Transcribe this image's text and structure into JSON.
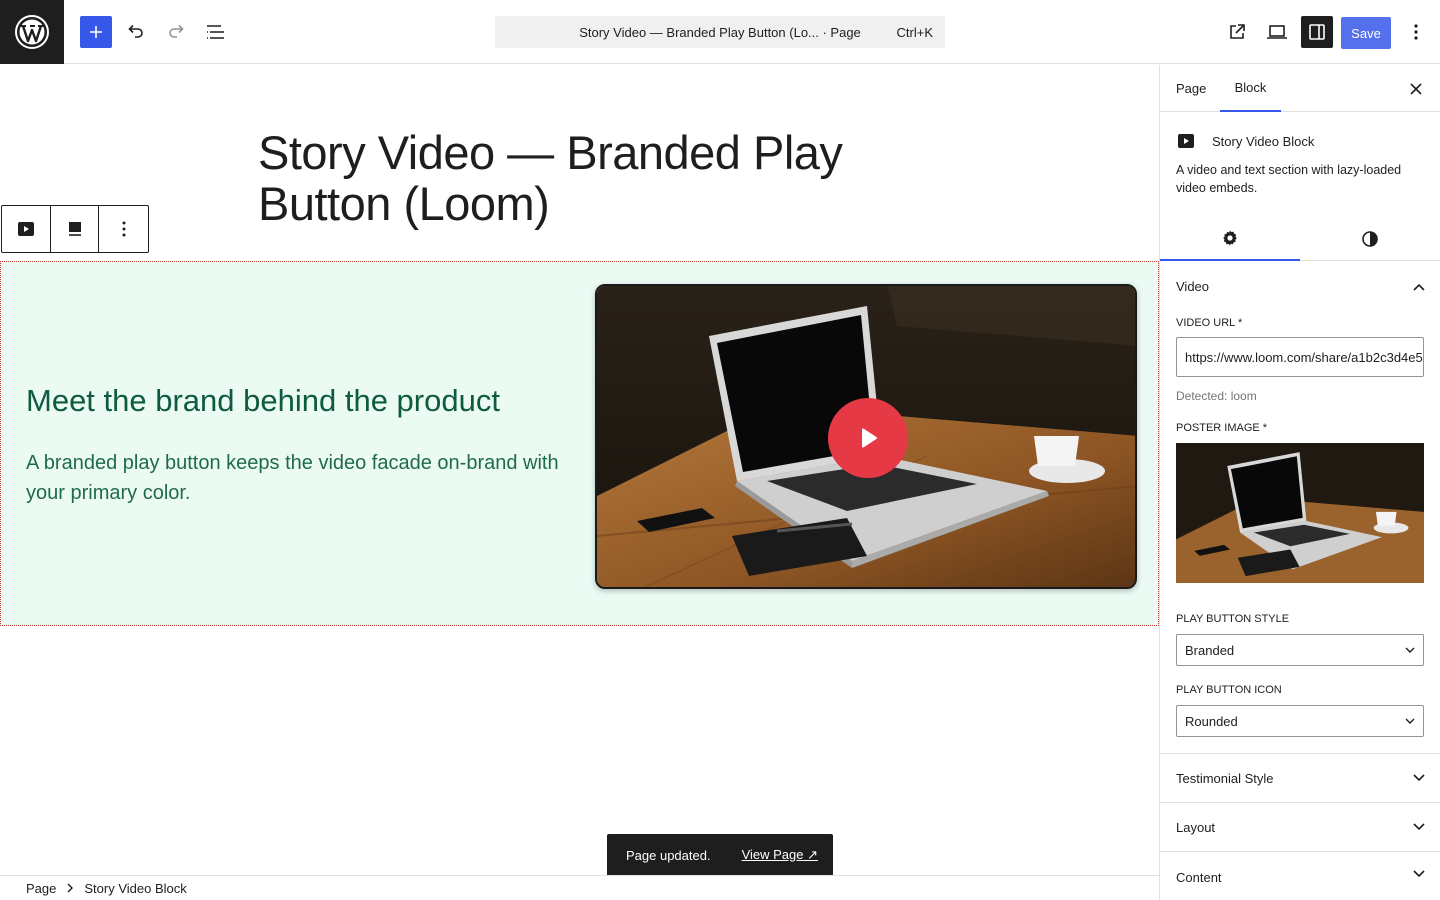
{
  "toolbar": {
    "document_title": "Story Video — Branded Play Button (Lo... · Page",
    "command_shortcut": "Ctrl+K",
    "save_label": "Save"
  },
  "editor": {
    "page_title": "Story Video — Branded Play Button (Loom)",
    "story": {
      "heading": "Meet the brand behind the product",
      "text": "A branded play button keeps the video facade on-brand with your primary color."
    }
  },
  "snackbar": {
    "message": "Page updated.",
    "link_label": "View Page ↗"
  },
  "breadcrumb": {
    "items": [
      "Page",
      "Story Video Block"
    ]
  },
  "sidebar": {
    "tabs": [
      "Page",
      "Block"
    ],
    "active_tab": "Block",
    "block": {
      "name": "Story Video Block",
      "description": "A video and text section with lazy-loaded video embeds."
    },
    "panels": {
      "video": {
        "title": "Video",
        "video_url_label": "VIDEO URL *",
        "video_url_value": "https://www.loom.com/share/a1b2c3d4e5",
        "detected_text": "Detected: loom",
        "poster_label": "POSTER IMAGE *",
        "play_style_label": "PLAY BUTTON STYLE",
        "play_style_value": "Branded",
        "play_icon_label": "PLAY BUTTON ICON",
        "play_icon_value": "Rounded"
      },
      "testimonial": {
        "title": "Testimonial Style"
      },
      "layout": {
        "title": "Layout"
      },
      "cut_off": {
        "title": "Content"
      }
    }
  },
  "colors": {
    "accent": "#3858e9",
    "story_bg": "#ebfbf4",
    "story_heading": "#0e5b3f",
    "play_button": "#e63946"
  }
}
